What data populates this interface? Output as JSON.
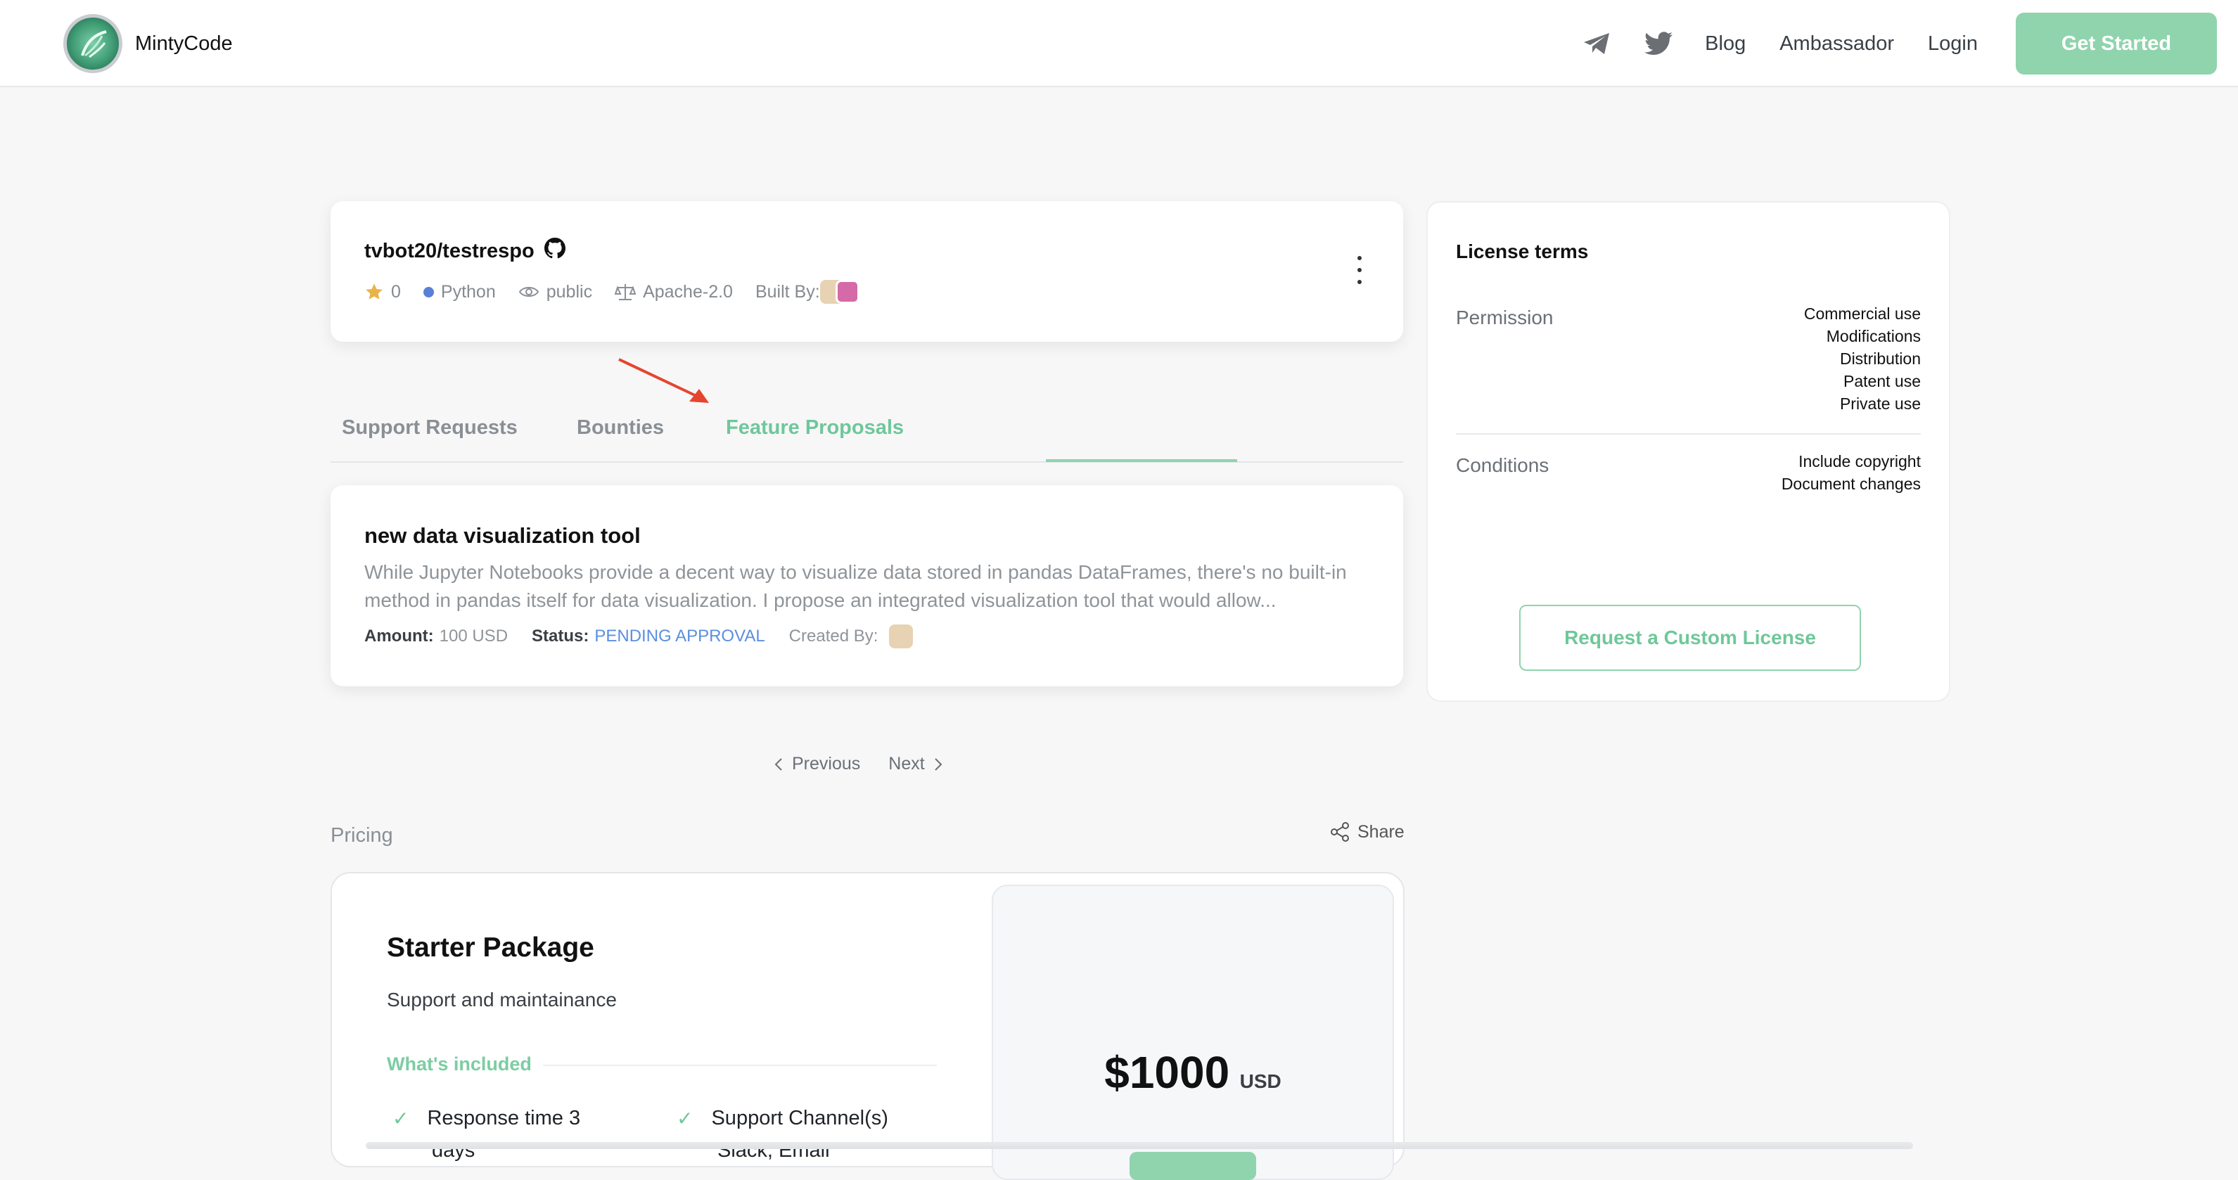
{
  "header": {
    "brand": "MintyCode",
    "nav": [
      "Blog",
      "Ambassador",
      "Login"
    ],
    "cta": "Get Started",
    "icons": [
      "telegram-icon",
      "twitter-icon"
    ]
  },
  "repo": {
    "title": "tvbot20/testrespo",
    "stars": "0",
    "language": "Python",
    "visibility": "public",
    "license": "Apache-2.0",
    "built_by_label": "Built By:"
  },
  "tabs": [
    {
      "label": "Support Requests",
      "active": false
    },
    {
      "label": "Bounties",
      "active": false
    },
    {
      "label": "Feature Proposals",
      "active": true
    }
  ],
  "proposal": {
    "title": "new data visualization tool",
    "description": "While Jupyter Notebooks provide a decent way to visualize data stored in pandas DataFrames, there's no built-in method in pandas itself for data visualization. I propose an integrated visualization tool that would allow...",
    "amount_label": "Amount:",
    "amount_value": "100 USD",
    "status_label": "Status:",
    "status_value": "PENDING APPROVAL",
    "created_by_label": "Created By:"
  },
  "pager": {
    "previous": "Previous",
    "next": "Next"
  },
  "pricing": {
    "section_label": "Pricing",
    "share": "Share",
    "package_title": "Starter Package",
    "package_subtitle": "Support and maintainance",
    "included_label": "What's included",
    "features": [
      "Response time 3",
      "Support Channel(s)"
    ],
    "features_cut": [
      "days",
      "Slack, Email"
    ],
    "price": "$1000",
    "currency": "USD"
  },
  "license": {
    "title": "License terms",
    "permission_label": "Permission",
    "permissions": [
      "Commercial use",
      "Modifications",
      "Distribution",
      "Patent use",
      "Private use"
    ],
    "conditions_label": "Conditions",
    "conditions": [
      "Include copyright",
      "Document changes"
    ],
    "button": "Request a Custom License"
  },
  "colors": {
    "accent": "#8fd4ad",
    "status": "#5b8fe0",
    "star": "#e8b44a",
    "annotation_arrow": "#e5452f"
  }
}
